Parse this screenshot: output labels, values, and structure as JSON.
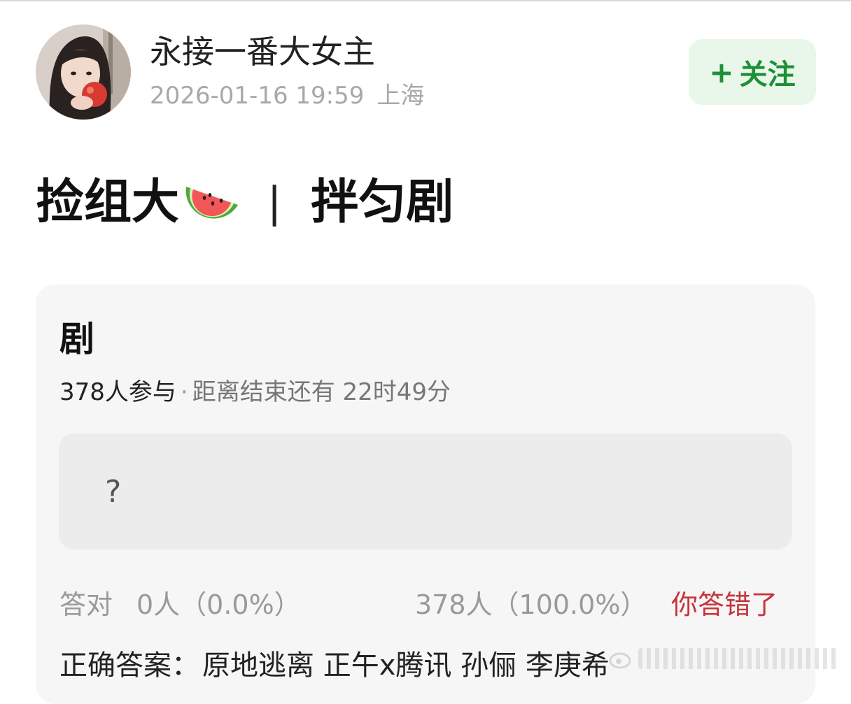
{
  "header": {
    "username": "永接一番大女主",
    "timestamp": "2026-01-16 19:59",
    "location": "上海",
    "follow": {
      "plus": "+",
      "label": "关注"
    }
  },
  "post": {
    "title_left": "捡组大",
    "separator": "|",
    "title_right": "拌匀剧",
    "emoji_icon": "watermelon-icon"
  },
  "quiz": {
    "title": "剧",
    "participants": "378人参与",
    "dot": "·",
    "remaining": "距离结束还有 22时49分",
    "option": "?",
    "result": {
      "label": "答对",
      "correct": "0人（0.0%）",
      "wrong": "378人（100.0%）",
      "verdict": "你答错了"
    },
    "answer_label": "正确答案：",
    "answer_value": "原地逃离 正午x腾讯 孙俪 李庚希"
  },
  "colors": {
    "follow_bg": "#e8f7ea",
    "follow_text": "#1f8f36",
    "card_bg": "#f6f6f6",
    "wrong_text": "#c7343a"
  }
}
